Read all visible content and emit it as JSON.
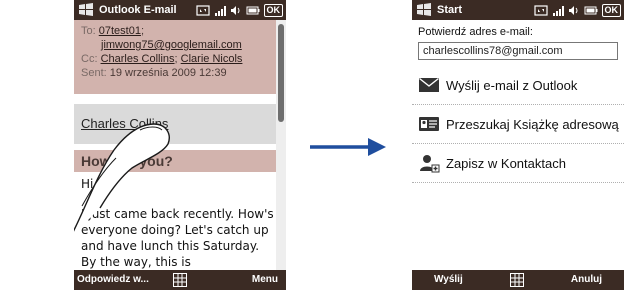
{
  "left_screen": {
    "app_title": "Outlook E-mail",
    "status": {
      "ok_label": "OK"
    },
    "header": {
      "to_label": "To:",
      "to_recipient_1": "07test01",
      "to_sep": ";",
      "to_recipient_2": "jimwong75@googlemail.com",
      "cc_label": "Cc:",
      "cc_recipient_1": "Charles Collins",
      "cc_sep": ";",
      "cc_recipient_2": "Clarie Nicols",
      "sent_label": "Sent:",
      "sent_value": "19 września 2009 12:39"
    },
    "sender_name": "Charles Collins",
    "subject": "How are you?",
    "body": {
      "greeting": "Hi,",
      "paragraph": "I just came back recently. How's everyone doing? Let's catch up and have lunch this Saturday. By the way, this is"
    },
    "softkeys": {
      "left": "Odpowiedz w...",
      "right": "Menu"
    }
  },
  "right_screen": {
    "app_title": "Start",
    "status": {
      "ok_label": "OK"
    },
    "prompt": "Potwierdź adres e-mail:",
    "email_value": "charlescollins78@gmail.com",
    "actions": [
      {
        "icon": "envelope-icon",
        "label": "Wyślij e-mail z Outlook"
      },
      {
        "icon": "address-book-icon",
        "label": "Przeszukaj Książkę adresową"
      },
      {
        "icon": "add-contact-icon",
        "label": "Zapisz w Kontaktach"
      }
    ],
    "softkeys": {
      "left": "Wyślij",
      "right": "Anuluj"
    }
  },
  "colors": {
    "bar": "#3b2b24",
    "header_bg": "#d2b3ad",
    "sender_bg": "#dadada",
    "arrow": "#1f4e9e"
  }
}
